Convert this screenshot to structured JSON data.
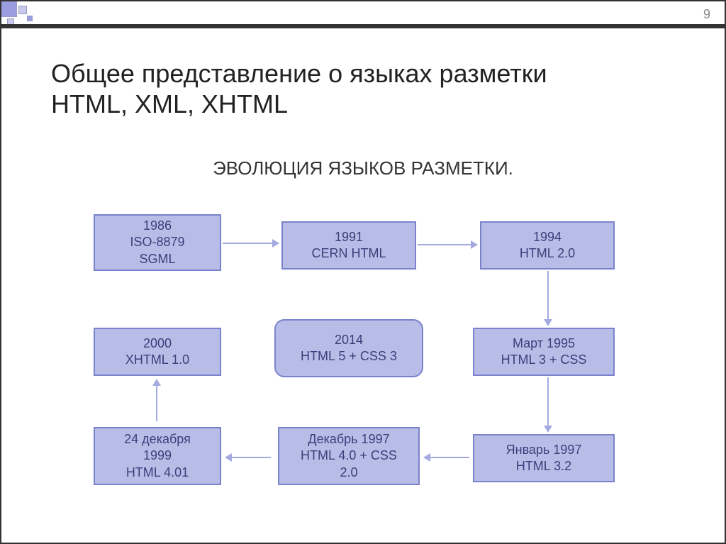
{
  "page_number": "9",
  "title_line1": "Общее представление о языках разметки",
  "title_line2": "HTML, XML, XHTML",
  "subtitle": "ЭВОЛЮЦИЯ ЯЗЫКОВ РАЗМЕТКИ.",
  "boxes": {
    "b1": {
      "line1": "1986",
      "line2": "ISO-8879",
      "line3": "SGML"
    },
    "b2": {
      "line1": "1991",
      "line2": "CERN HTML"
    },
    "b3": {
      "line1": "1994",
      "line2": "HTML 2.0"
    },
    "b4": {
      "line1": "2000",
      "line2": "XHTML 1.0"
    },
    "b5": {
      "line1": "2014",
      "line2": "HTML 5 + CSS 3"
    },
    "b6": {
      "line1": "Март 1995",
      "line2": "HTML 3 +  CSS"
    },
    "b7": {
      "line1": "24 декабря",
      "line2": "1999",
      "line3": "HTML 4.01"
    },
    "b8": {
      "line1": "Декабрь 1997",
      "line2": "HTML 4.0 + CSS",
      "line3": "2.0"
    },
    "b9": {
      "line1": "Январь 1997",
      "line2": "HTML 3.2"
    }
  },
  "chart_data": {
    "type": "diagram",
    "title": "ЭВОЛЮЦИЯ ЯЗЫКОВ РАЗМЕТКИ.",
    "nodes": [
      {
        "id": "b1",
        "label": "1986 ISO-8879 SGML"
      },
      {
        "id": "b2",
        "label": "1991 CERN HTML"
      },
      {
        "id": "b3",
        "label": "1994 HTML 2.0"
      },
      {
        "id": "b6",
        "label": "Март 1995 HTML 3 + CSS"
      },
      {
        "id": "b9",
        "label": "Январь 1997 HTML 3.2"
      },
      {
        "id": "b8",
        "label": "Декабрь 1997 HTML 4.0 + CSS 2.0"
      },
      {
        "id": "b7",
        "label": "24 декабря 1999 HTML 4.01"
      },
      {
        "id": "b4",
        "label": "2000 XHTML 1.0"
      },
      {
        "id": "b5",
        "label": "2014 HTML 5 + CSS 3",
        "highlight": true
      }
    ],
    "edges": [
      {
        "from": "b1",
        "to": "b2"
      },
      {
        "from": "b2",
        "to": "b3"
      },
      {
        "from": "b3",
        "to": "b6"
      },
      {
        "from": "b6",
        "to": "b9"
      },
      {
        "from": "b9",
        "to": "b8"
      },
      {
        "from": "b8",
        "to": "b7"
      },
      {
        "from": "b7",
        "to": "b4"
      }
    ]
  }
}
